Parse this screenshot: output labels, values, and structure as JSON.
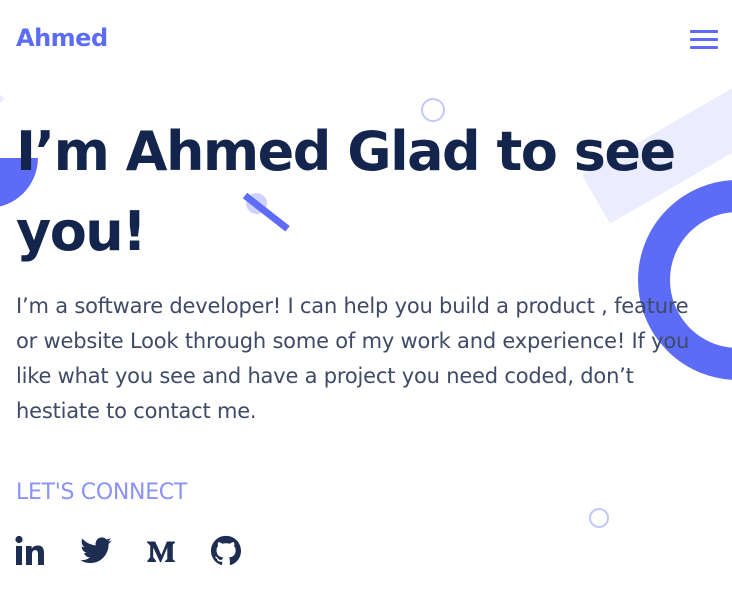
{
  "brand": {
    "name": "Ahmed",
    "accent_color": "#5d6cf6",
    "heading_color": "#14254d"
  },
  "header": {
    "menu_icon": "hamburger-menu-icon"
  },
  "hero": {
    "title": "I’m Ahmed Glad to see you!",
    "description": "I’m a software developer! I can help you build a product , feature or website Look through some of my work and experience! If you like what you see and have a project you need coded, don’t hestiate to contact me."
  },
  "connect": {
    "label": "LET'S CONNECT",
    "links": [
      {
        "icon": "linkedin-icon"
      },
      {
        "icon": "twitter-icon"
      },
      {
        "icon": "medium-icon"
      },
      {
        "icon": "github-icon"
      }
    ]
  }
}
